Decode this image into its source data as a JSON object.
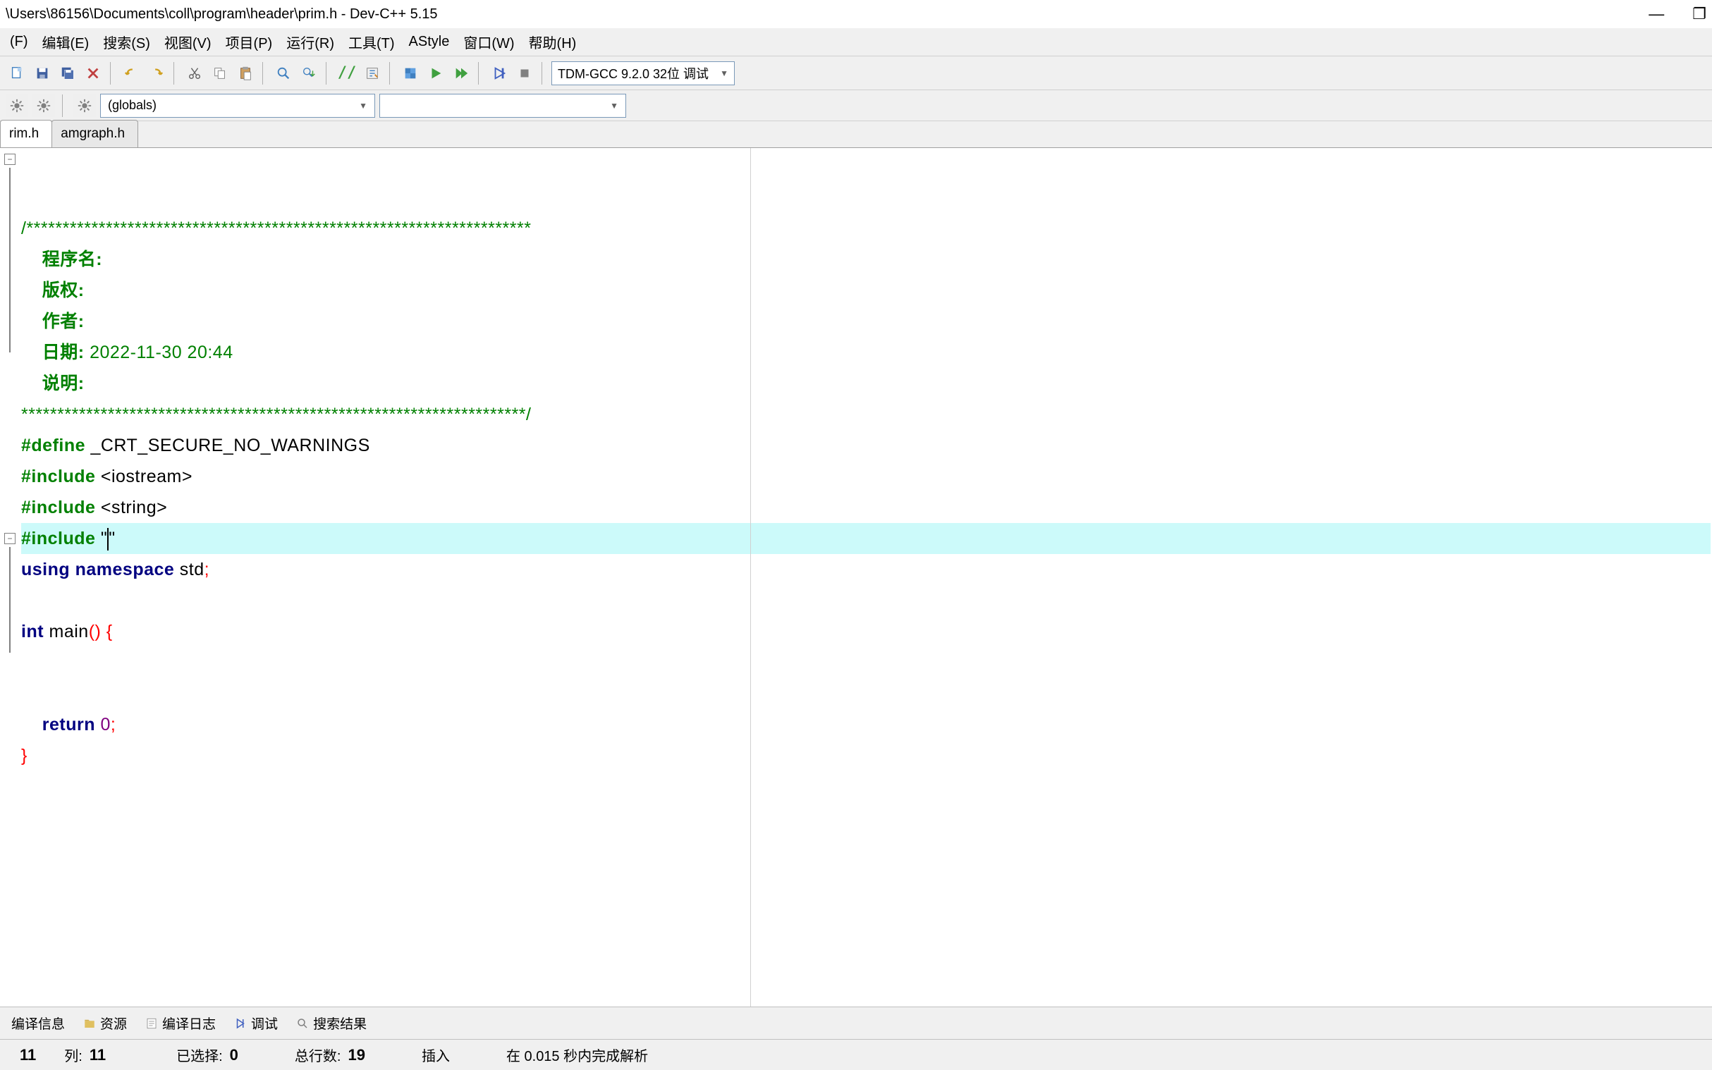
{
  "titlebar": {
    "path": "\\Users\\86156\\Documents\\coll\\program\\header\\prim.h - Dev-C++ 5.15"
  },
  "menu": {
    "file": "(F)",
    "edit": "编辑(E)",
    "search": "搜索(S)",
    "view": "视图(V)",
    "project": "项目(P)",
    "run": "运行(R)",
    "tools": "工具(T)",
    "astyle": "AStyle",
    "window": "窗口(W)",
    "help": "帮助(H)"
  },
  "toolbar": {
    "compiler_combo": "TDM-GCC 9.2.0 32位 调试"
  },
  "symbol_combo": "(globals)",
  "tabs": {
    "active": "rim.h",
    "second": "amgraph.h"
  },
  "code": {
    "l1": "/**********************************************************************",
    "l2_label": "程序名:",
    "l3_label": "版权:",
    "l4_label": "作者:",
    "l5_label": "日期:",
    "l5_val": " 2022-11-30 20:44",
    "l6_label": "说明:",
    "l7": "**********************************************************************/",
    "l8_def": "#define",
    "l8_id": " _CRT_SECURE_NO_WARNINGS",
    "l9_inc": "#include",
    "l9_h": " <iostream>",
    "l10_inc": "#include",
    "l10_h": " <string>",
    "l11_inc": "#include",
    "l11_q": " \"",
    "l11_q2": "\"",
    "l12_using": "using",
    "l12_ns": " namespace",
    "l12_std": " std",
    "l12_semi": ";",
    "l14_int": "int",
    "l14_main": " main",
    "l14_paren": "()",
    "l14_brace": " {",
    "l16_ret": "return",
    "l16_zero": " 0",
    "l16_semi": ";",
    "l17_brace": "}"
  },
  "bottom_tabs": {
    "compile": "编译信息",
    "res": "资源",
    "log": "编译日志",
    "debug": "调试",
    "search": "搜索结果"
  },
  "status": {
    "line_val": "11",
    "col_label": "列:",
    "col_val": "11",
    "sel_label": "已选择:",
    "sel_val": "0",
    "total_label": "总行数:",
    "total_val": "19",
    "ins": "插入",
    "parse": "在 0.015 秒内完成解析"
  }
}
